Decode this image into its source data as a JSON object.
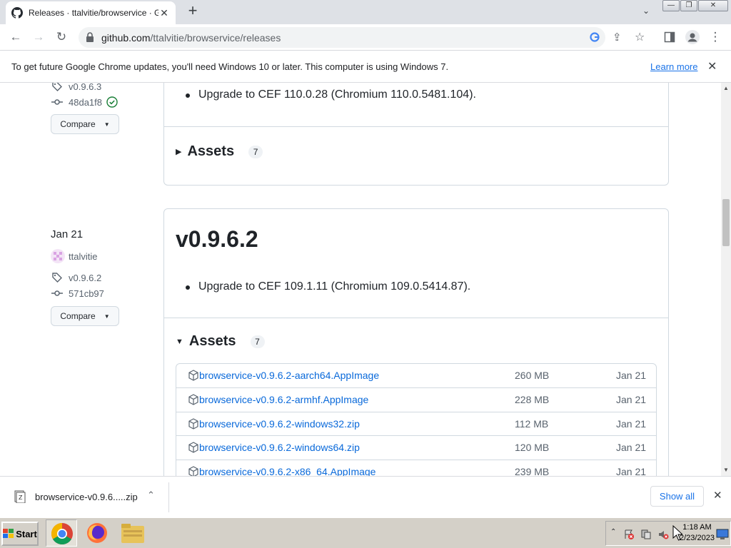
{
  "browser": {
    "tab_title": "Releases · ttalvitie/browservice · GitHub",
    "new_tab": "+",
    "tab_close": "✕",
    "url_host": "github.com",
    "url_path": "/ttalvitie/browservice/releases",
    "window_min": "—",
    "window_restore": "❐",
    "window_close": "✕"
  },
  "infobar": {
    "message": "To get future Google Chrome updates, you'll need Windows 10 or later. This computer is using Windows 7.",
    "learn_more": "Learn more",
    "close": "✕"
  },
  "releases": [
    {
      "tag": "v0.9.6.3",
      "commit": "48da1f8",
      "compare_label": "Compare",
      "notes": [
        "Upgrade to CEF 110.0.28 (Chromium 110.0.5481.104)."
      ],
      "assets_label": "Assets",
      "assets_count": "7",
      "expanded": false
    },
    {
      "date": "Jan 21",
      "author": "ttalvitie",
      "tag": "v0.9.6.2",
      "commit": "571cb97",
      "compare_label": "Compare",
      "title": "v0.9.6.2",
      "notes": [
        "Upgrade to CEF 109.1.11 (Chromium 109.0.5414.87)."
      ],
      "assets_label": "Assets",
      "assets_count": "7",
      "expanded": true,
      "assets": [
        {
          "name": "browservice-v0.9.6.2-aarch64.AppImage",
          "size": "260 MB",
          "date": "Jan 21"
        },
        {
          "name": "browservice-v0.9.6.2-armhf.AppImage",
          "size": "228 MB",
          "date": "Jan 21"
        },
        {
          "name": "browservice-v0.9.6.2-windows32.zip",
          "size": "112 MB",
          "date": "Jan 21"
        },
        {
          "name": "browservice-v0.9.6.2-windows64.zip",
          "size": "120 MB",
          "date": "Jan 21"
        },
        {
          "name": "browservice-v0.9.6.2-x86_64.AppImage",
          "size": "239 MB",
          "date": "Jan 21"
        }
      ]
    }
  ],
  "download_shelf": {
    "filename": "browservice-v0.9.6.....zip",
    "show_all": "Show all",
    "close": "✕"
  },
  "taskbar": {
    "start_label": "Start",
    "time": "1:18 AM",
    "date": "2/23/2023"
  },
  "colors": {
    "link": "#0969da",
    "chrome_link": "#1a73e8",
    "tab_strip": "#dee1e6",
    "taskbar": "#d4d0c8"
  }
}
